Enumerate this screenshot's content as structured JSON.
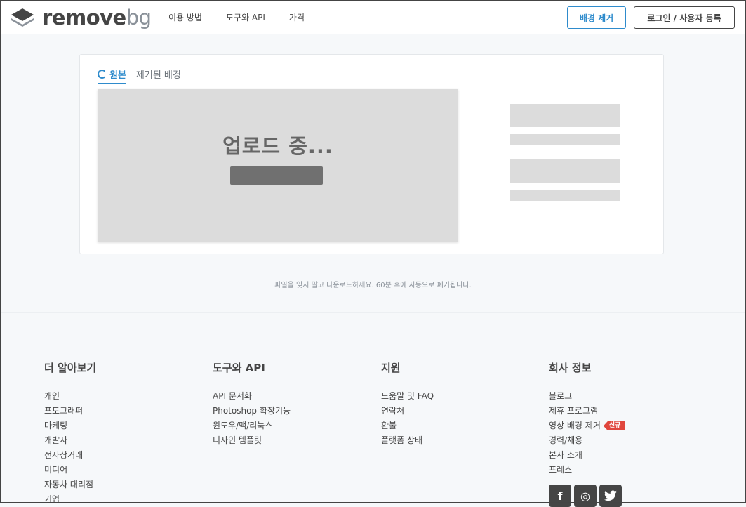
{
  "header": {
    "logo": {
      "word_main": "remove",
      "word_accent": "bg"
    },
    "nav": [
      "이용 방법",
      "도구와 API",
      "가격"
    ],
    "remove_bg_button": "배경 제거",
    "login_button": "로그인 / 사용자 등록"
  },
  "card": {
    "tabs": {
      "original": "원본",
      "removed": "제거된 배경"
    },
    "uploading_text": "업로드 중...",
    "progress": 1.0
  },
  "notice": "파일을 잊지 말고 다운로드하세요. 60분 후에 자동으로 폐기됩니다.",
  "footer": {
    "columns": [
      {
        "title": "더 알아보기",
        "items": [
          "개인",
          "포토그래퍼",
          "마케팅",
          "개발자",
          "전자상거래",
          "미디어",
          "자동차 대리점",
          "기업"
        ]
      },
      {
        "title": "도구와 API",
        "items": [
          "API 문서화",
          "Photoshop 확장기능",
          "윈도우/맥/리눅스",
          "디자인 템플릿"
        ]
      },
      {
        "title": "지원",
        "items": [
          "도움말 및 FAQ",
          "연락처",
          "환불",
          "플랫폼 상태"
        ]
      },
      {
        "title": "회사 정보",
        "items": [
          "블로그",
          "제휴 프로그램",
          "영상 배경 제거",
          "경력/채용",
          "본사 소개",
          "프레스"
        ],
        "badge": "신규"
      }
    ],
    "socials": [
      {
        "icon": "facebook-icon",
        "glyph": "f"
      },
      {
        "icon": "instagram-icon",
        "glyph": "◎"
      },
      {
        "icon": "twitter-icon",
        "glyph": "🐦"
      }
    ]
  },
  "colors": {
    "accent": "#2e8bcc",
    "text": "#454545",
    "badge": "#e0463d",
    "skeleton": "#dcdcdc"
  }
}
